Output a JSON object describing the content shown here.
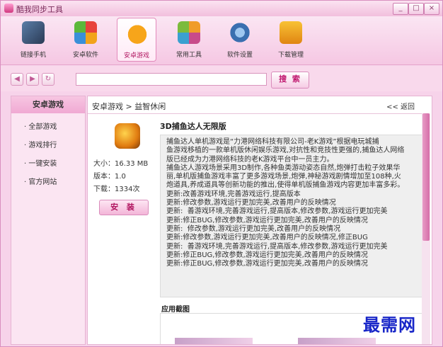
{
  "window": {
    "title": "酷我同步工具",
    "buttons": [
      "_",
      "□",
      "×"
    ]
  },
  "toolbar": [
    {
      "label": "链接手机",
      "icon": "phone-link-icon",
      "active": false
    },
    {
      "label": "安卓软件",
      "icon": "android-apps-icon",
      "active": false
    },
    {
      "label": "安卓游戏",
      "icon": "gamepad-icon",
      "active": true
    },
    {
      "label": "常用工具",
      "icon": "tools-icon",
      "active": false
    },
    {
      "label": "软件设置",
      "icon": "settings-icon",
      "active": false
    },
    {
      "label": "下载管理",
      "icon": "download-icon",
      "active": false
    }
  ],
  "search": {
    "value": "",
    "button": "搜 索"
  },
  "sidebar": {
    "title": "安卓游戏",
    "items": [
      "全部游戏",
      "游戏排行",
      "一键安装",
      "官方网站"
    ]
  },
  "main": {
    "breadcrumb": "安卓游戏 > 益智休闲",
    "back": "<< 返回",
    "app": {
      "title": "3D捕鱼达人无限版",
      "size": "大小：16.33 MB",
      "version": "版本：1.0",
      "downloads": "下载：1334次",
      "install": "安 装"
    },
    "description": [
      "捕鱼达人单机游戏是“力港网络科技有限公司-老K游戏”根据电玩城捕",
      "鱼游戏移植的一款单机版休闲娱乐游戏,对抗性和竞技性更强的,捕鱼达人网络",
      "版已经成为力港网络科技的老K游戏平台中一员主力。",
      "捕鱼达人游戏场景采用3D制作,各种鱼类游动姿态自然,炮弹打击粒子效果华",
      "丽,单机版捕鱼游戏丰富了更多游戏场景,炮弹,神秘游戏剧情增加至108种,火",
      "炮道具,养成道具等创新功能的推出,使得单机版捕鱼游戏内容更加丰富多彩。",
      "更新:改善游戏环境,完善游戏运行,提高版本",
      "更新:修改参数,游戏运行更加完美,改善用户的反映情况",
      "更新:  善游戏环境,完善游戏运行,提高版本,修改参数,游戏运行更加完美",
      "更新:修正BUG,修改参数,游戏运行更加完美,改善用户的反映情况",
      "更新:  修改参数,游戏运行更加完美,改善用户的反映情况",
      "更新:修改参数,游戏运行更加完美,改善用户的反映情况,修正BUG",
      "更新:  善游戏环境,完善游戏运行,提高版本,修改参数,游戏运行更加完美",
      "更新:修正BUG,修改参数,游戏运行更加完美,改善用户的反映情况",
      "更新:修正BUG,修改参数,游戏运行更加完美,改善用户的反映情况"
    ],
    "screenshots_title": "应用截图"
  },
  "watermark": "最需网"
}
